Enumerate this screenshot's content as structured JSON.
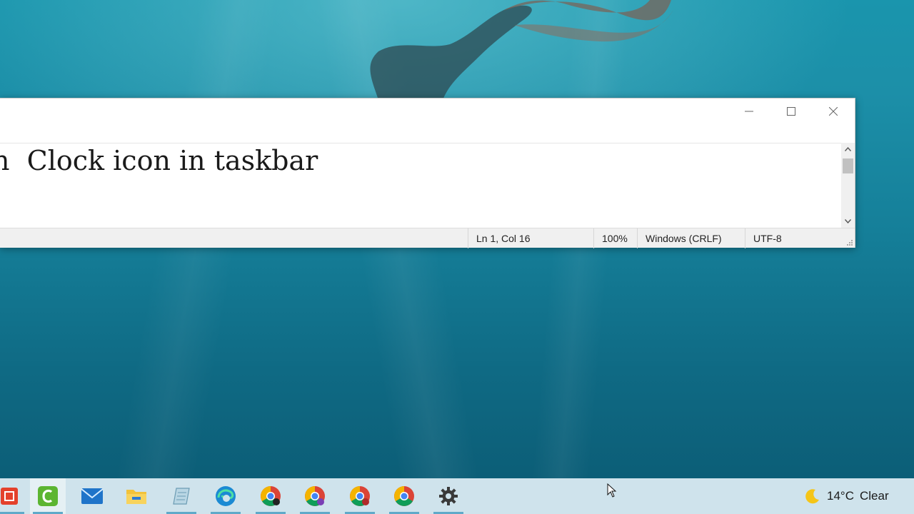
{
  "editor": {
    "text": "ion  Clock icon in taskbar"
  },
  "window_controls": {
    "minimize_icon": "minimize-icon",
    "maximize_icon": "maximize-icon",
    "close_icon": "close-icon"
  },
  "statusbar": {
    "position": "Ln 1, Col 16",
    "zoom": "100%",
    "line_ending": "Windows (CRLF)",
    "encoding": "UTF-8"
  },
  "taskbar": {
    "apps": [
      {
        "name": "red-app",
        "icon": "red-square-icon",
        "active": false
      },
      {
        "name": "camtasia",
        "icon": "green-c-icon",
        "active": true
      },
      {
        "name": "mail",
        "icon": "mail-icon",
        "active": false
      },
      {
        "name": "file-explorer",
        "icon": "folder-icon",
        "active": false
      },
      {
        "name": "notepad",
        "icon": "notepad-icon",
        "active": false
      },
      {
        "name": "edge",
        "icon": "edge-icon",
        "active": false
      },
      {
        "name": "chrome-profile-1",
        "icon": "chrome-icon",
        "active": false
      },
      {
        "name": "chrome-profile-2",
        "icon": "chrome-icon",
        "active": false
      },
      {
        "name": "chrome-profile-3",
        "icon": "chrome-icon",
        "active": false
      },
      {
        "name": "chrome",
        "icon": "chrome-icon",
        "active": false
      },
      {
        "name": "settings",
        "icon": "gear-icon",
        "active": false
      }
    ],
    "weather": {
      "icon": "moon-icon",
      "temperature": "14°C",
      "condition": "Clear"
    }
  },
  "colors": {
    "taskbar_bg": "#cfe3ec",
    "taskbar_underline": "#5fa9c9",
    "desktop_water": "#157f99"
  }
}
